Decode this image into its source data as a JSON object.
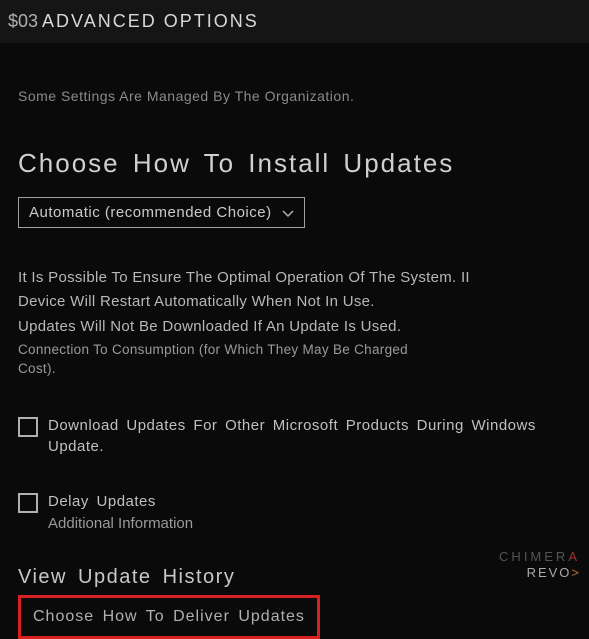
{
  "titlebar": {
    "prefix": "$03",
    "title": "ADVANCED OPTIONS"
  },
  "orgNote": "Some Settings Are Managed By The Organization.",
  "heading": "Choose How To Install Updates",
  "dropdown": {
    "selected": "Automatic (recommended Choice)"
  },
  "body": {
    "line1": "It Is Possible To Ensure The Optimal Operation Of The System. II",
    "line2": "Device Will Restart Automatically When Not In Use.",
    "line3": "Updates Will Not Be Downloaded If An Update Is Used.",
    "line4": "Connection To Consumption (for Which They May Be Charged",
    "line5": "Cost)."
  },
  "check1": {
    "label": "Download Updates For Other Microsoft Products During Windows Update."
  },
  "check2": {
    "label": "Delay Updates",
    "sub": "Additional Information"
  },
  "links": {
    "history": "View Update History",
    "deliver": "Choose How To Deliver Updates"
  },
  "watermark": {
    "line1a": "CHIMER",
    "line1b": "A",
    "line2a": "REVO",
    "line2b": ">"
  }
}
